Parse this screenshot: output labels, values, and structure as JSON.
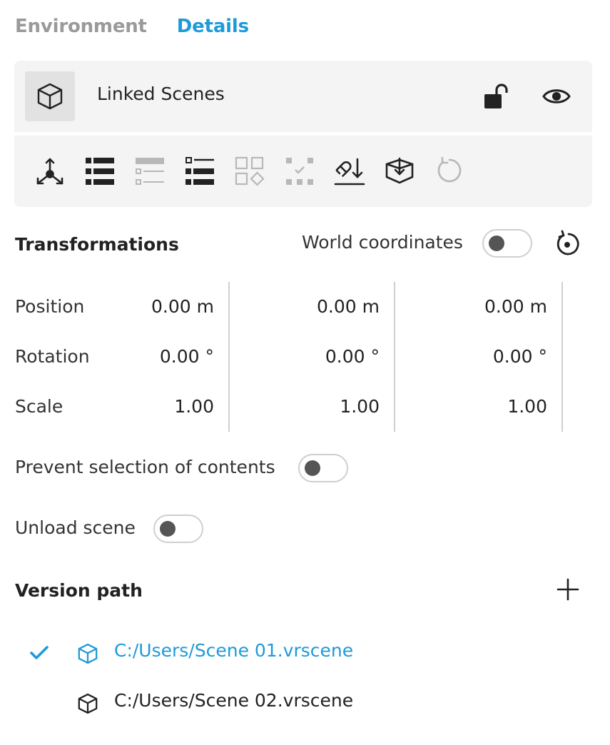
{
  "tabs": [
    {
      "label": "Environment",
      "active": false
    },
    {
      "label": "Details",
      "active": true
    }
  ],
  "header": {
    "title": "Linked Scenes",
    "icon": "cube-icon",
    "lock_icon": "unlocked-padlock-icon",
    "visibility_icon": "eye-icon"
  },
  "toolbar": {
    "tools": [
      {
        "name": "transform-gizmo-icon",
        "enabled": true
      },
      {
        "name": "list-full-icon",
        "enabled": true
      },
      {
        "name": "list-partial-icon",
        "enabled": false
      },
      {
        "name": "list-checked-icon",
        "enabled": true
      },
      {
        "name": "grid-shapes-icon",
        "enabled": false
      },
      {
        "name": "scatter-select-icon",
        "enabled": false
      },
      {
        "name": "snap-to-ground-icon",
        "enabled": true
      },
      {
        "name": "box-import-icon",
        "enabled": true
      },
      {
        "name": "refresh-icon",
        "enabled": false
      }
    ]
  },
  "transformations": {
    "title": "Transformations",
    "world_coordinates_label": "World coordinates",
    "world_coordinates_on": false,
    "rows": [
      {
        "label": "Position",
        "values": [
          "0.00 m",
          "0.00 m",
          "0.00 m"
        ]
      },
      {
        "label": "Rotation",
        "values": [
          "0.00 °",
          "0.00 °",
          "0.00 °"
        ]
      },
      {
        "label": "Scale",
        "values": [
          "1.00",
          "1.00",
          "1.00"
        ]
      }
    ]
  },
  "options": {
    "prevent_selection_label": "Prevent selection of contents",
    "prevent_selection_on": false,
    "unload_scene_label": "Unload scene",
    "unload_scene_on": false
  },
  "version_path": {
    "title": "Version path",
    "items": [
      {
        "path": "C:/Users/Scene 01.vrscene",
        "selected": true
      },
      {
        "path": "C:/Users/Scene 02.vrscene",
        "selected": false
      }
    ]
  },
  "colors": {
    "accent": "#1e9bd7",
    "inactive_tab": "#9a9a9a",
    "panel_bg": "#f4f4f4",
    "disabled_icon": "#b8b8b8",
    "icon": "#222222"
  }
}
